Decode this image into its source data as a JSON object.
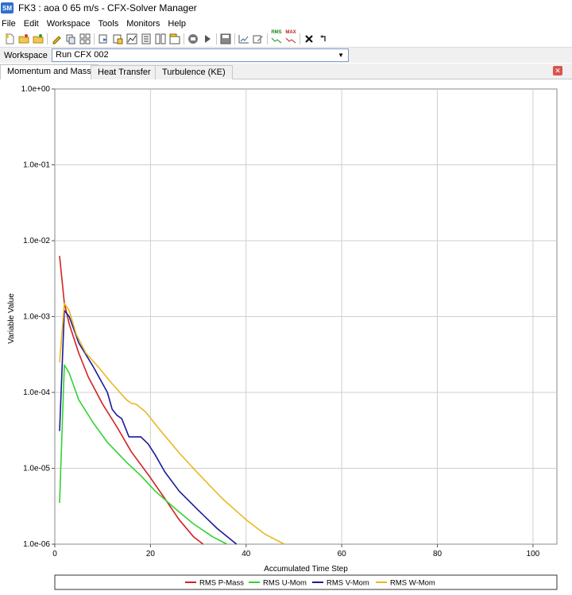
{
  "window": {
    "app_icon": "SM",
    "title": "FK3 : aoa 0 65 m/s - CFX-Solver Manager"
  },
  "menu": [
    "File",
    "Edit",
    "Workspace",
    "Tools",
    "Monitors",
    "Help"
  ],
  "toolbar": {
    "icons": [
      "new-file-icon",
      "open-file-icon",
      "open-results-icon",
      "edit-icon",
      "copy-icon",
      "tile-icon",
      "export-icon",
      "monitor-icon",
      "plot-icon",
      "text-icon",
      "layout-icon",
      "workspace-icon",
      "stop-icon",
      "play-icon",
      "save-icon",
      "edit-chart-icon",
      "edit-run-icon",
      "rms-icon",
      "max-icon",
      "close-x-icon",
      "reset-icon"
    ],
    "rms_label": "RMS",
    "max_label": "MAX"
  },
  "workspace": {
    "label": "Workspace",
    "selected": "Run CFX 002"
  },
  "tabs": [
    {
      "label": "Momentum and Mass",
      "active": true
    },
    {
      "label": "Heat Transfer",
      "active": false
    },
    {
      "label": "Turbulence (KE)",
      "active": false
    }
  ],
  "chart_data": {
    "type": "line",
    "xlabel": "Accumulated Time Step",
    "ylabel": "Variable Value",
    "xlim": [
      0,
      105
    ],
    "x_ticks": [
      0,
      20,
      40,
      60,
      80,
      100
    ],
    "ylim": [
      1e-06,
      1
    ],
    "yscale": "log",
    "y_ticks": [
      1e-06,
      1e-05,
      0.0001,
      0.001,
      0.01,
      0.1,
      1
    ],
    "y_tick_labels": [
      "1.0e-06",
      "1.0e-05",
      "1.0e-04",
      "1.0e-03",
      "1.0e-02",
      "1.0e-01",
      "1.0e+00"
    ],
    "grid": true,
    "legend_placement": "bottom",
    "series": [
      {
        "name": "RMS P-Mass",
        "color": "#d42020",
        "points": [
          [
            1,
            0.0063
          ],
          [
            2,
            0.0015
          ],
          [
            3,
            0.0008
          ],
          [
            5,
            0.00033
          ],
          [
            7,
            0.00016
          ],
          [
            10,
            7e-05
          ],
          [
            13,
            3.5e-05
          ],
          [
            16,
            1.65e-05
          ],
          [
            20,
            7.5e-06
          ],
          [
            23,
            4e-06
          ],
          [
            26,
            2.1e-06
          ],
          [
            29,
            1.25e-06
          ],
          [
            31,
            1e-06
          ]
        ]
      },
      {
        "name": "RMS U-Mom",
        "color": "#32d232",
        "points": [
          [
            1,
            3.5e-06
          ],
          [
            2,
            0.00023
          ],
          [
            3,
            0.00018
          ],
          [
            5,
            8e-05
          ],
          [
            8,
            4e-05
          ],
          [
            11,
            2.2e-05
          ],
          [
            15,
            1.2e-05
          ],
          [
            18,
            8e-06
          ],
          [
            21,
            5e-06
          ],
          [
            25,
            3e-06
          ],
          [
            29,
            1.85e-06
          ],
          [
            33,
            1.25e-06
          ],
          [
            36,
            1e-06
          ]
        ]
      },
      {
        "name": "RMS V-Mom",
        "color": "#1a1a9c",
        "points": [
          [
            1,
            3.1e-05
          ],
          [
            2,
            0.0012
          ],
          [
            3,
            0.001
          ],
          [
            5,
            0.00045
          ],
          [
            8,
            0.00022
          ],
          [
            11,
            0.0001
          ],
          [
            12,
            6e-05
          ],
          [
            13,
            5e-05
          ],
          [
            14,
            4.5e-05
          ],
          [
            15.5,
            2.6e-05
          ],
          [
            18,
            2.6e-05
          ],
          [
            19.5,
            2.1e-05
          ],
          [
            21,
            1.5e-05
          ],
          [
            23,
            9e-06
          ],
          [
            26,
            5e-06
          ],
          [
            30,
            2.8e-06
          ],
          [
            34,
            1.6e-06
          ],
          [
            38,
            1e-06
          ]
        ]
      },
      {
        "name": "RMS W-Mom",
        "color": "#e8b820",
        "points": [
          [
            1,
            0.00025
          ],
          [
            2,
            0.0015
          ],
          [
            3,
            0.0012
          ],
          [
            4.5,
            0.00058
          ],
          [
            6.5,
            0.00033
          ],
          [
            9,
            0.00022
          ],
          [
            12,
            0.00013
          ],
          [
            15,
            8e-05
          ],
          [
            16,
            7.2e-05
          ],
          [
            17,
            7e-05
          ],
          [
            19,
            5.5e-05
          ],
          [
            22,
            3.2e-05
          ],
          [
            26,
            1.6e-05
          ],
          [
            30,
            8.5e-06
          ],
          [
            35,
            4e-06
          ],
          [
            40,
            2.1e-06
          ],
          [
            44,
            1.35e-06
          ],
          [
            48,
            1e-06
          ]
        ]
      }
    ]
  }
}
